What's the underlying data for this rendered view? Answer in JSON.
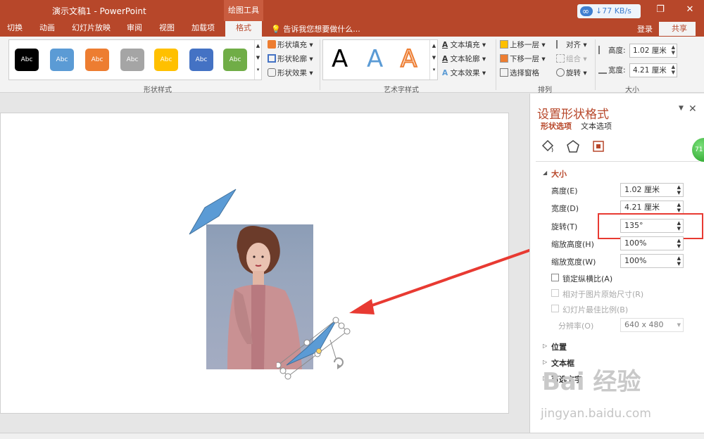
{
  "titlebar": {
    "title": "演示文稿1 - PowerPoint",
    "context_tab_group": "绘图工具",
    "speed": "↓77 KB/s",
    "restore_glyph": "❐",
    "close_glyph": "✕"
  },
  "tabs": [
    "切换",
    "动画",
    "幻灯片放映",
    "审阅",
    "视图",
    "加载项",
    "格式"
  ],
  "active_tab": "格式",
  "tell_me": "告诉我您想要做什么...",
  "account": {
    "login": "登录",
    "share": "共享"
  },
  "ribbon": {
    "shape_styles": {
      "sample_text": "Abc",
      "colors": [
        "#000000",
        "#5b9bd5",
        "#ed7d31",
        "#a5a5a5",
        "#ffc000",
        "#4472c4",
        "#70ad47"
      ],
      "fill": "形状填充",
      "outline": "形状轮廓",
      "effects": "形状效果",
      "group_label": "形状样式"
    },
    "wordart": {
      "letter": "A",
      "text_fill": "文本填充",
      "text_outline": "文本轮廓",
      "text_effects": "文本效果",
      "group_label": "艺术字样式"
    },
    "arrange": {
      "bring_forward": "上移一层",
      "send_backward": "下移一层",
      "selection_pane": "选择窗格",
      "align": "对齐",
      "group": "组合",
      "rotate": "旋转",
      "group_label": "排列"
    },
    "size": {
      "height_label": "高度:",
      "height_value": "1.02 厘米",
      "width_label": "宽度:",
      "width_value": "4.21 厘米",
      "group_label": "大小"
    }
  },
  "pane": {
    "title": "设置形状格式",
    "tab_shape": "形状选项",
    "tab_text": "文本选项",
    "section_size": "大小",
    "height_label": "高度(E)",
    "height_value": "1.02 厘米",
    "width_label": "宽度(D)",
    "width_value": "4.21 厘米",
    "rotation_label": "旋转(T)",
    "rotation_value": "135°",
    "scale_height_label": "缩放高度(H)",
    "scale_height_value": "100%",
    "scale_width_label": "缩放宽度(W)",
    "scale_width_value": "100%",
    "lock_aspect": "锁定纵横比(A)",
    "relative_original": "相对于图片原始尺寸(R)",
    "best_scale": "幻灯片最佳比例(B)",
    "resolution_label": "分辨率(O)",
    "resolution_value": "640 x 480",
    "position": "位置",
    "textbox": "文本框",
    "alt_text": "可选文字"
  },
  "watermark": {
    "main": "Bai 经验",
    "sub": "jingyan.baidu.com"
  },
  "badge": "71",
  "colors": {
    "accent": "#b7472a",
    "shape_blue": "#5b9bd5",
    "arrow_red": "#e83a32"
  }
}
